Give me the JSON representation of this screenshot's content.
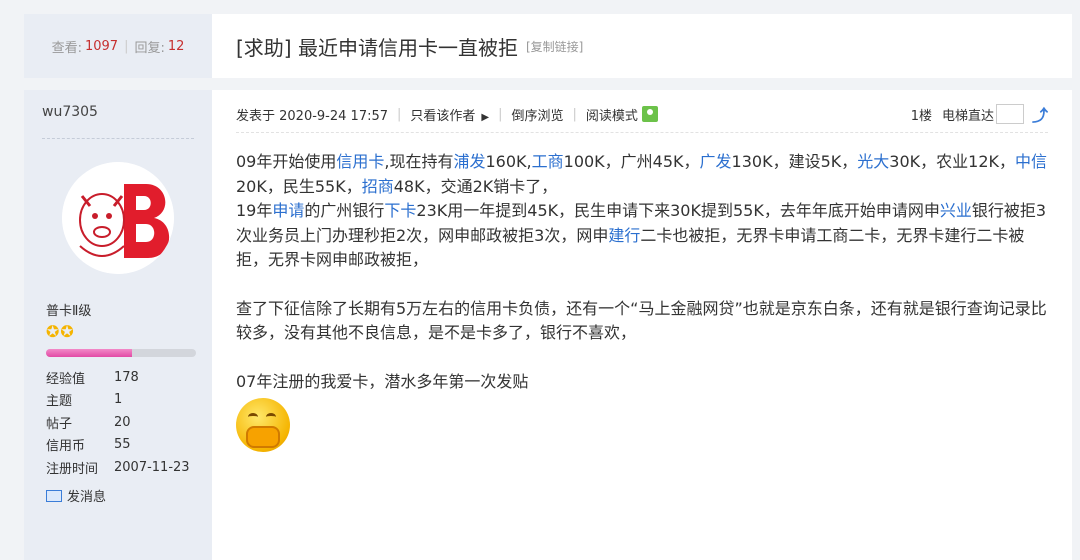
{
  "header": {
    "views_label": "查看:",
    "views_value": "1097",
    "replies_label": "回复:",
    "replies_value": "12",
    "thread_title": "[求助] 最近申请信用卡一直被拒",
    "copy_link": "[复制链接]"
  },
  "author": {
    "username": "wu7305",
    "avatar_letter": "B",
    "rank": "普卡Ⅱ级",
    "stars": "✪✪",
    "level_progress": 0.57,
    "stats": [
      {
        "label": "经验值",
        "value": "178"
      },
      {
        "label": "主题",
        "value": "1"
      },
      {
        "label": "帖子",
        "value": "20"
      },
      {
        "label": "信用币",
        "value": "55"
      },
      {
        "label": "注册时间",
        "value": "2007-11-23"
      }
    ],
    "send_message": "发消息"
  },
  "post_meta": {
    "posted": "发表于 2020-9-24 17:57",
    "only_author": "只看该作者",
    "reverse": "倒序浏览",
    "read_mode": "阅读模式",
    "floor": "1楼",
    "elevator": "电梯直达"
  },
  "post": {
    "p1": [
      "09年开始使用",
      "信用卡",
      ",现在持有",
      "浦发",
      "160K,",
      "工商",
      "100K，广州45K，",
      "广发",
      "130K，建设5K，",
      "光大",
      "30K，农业12K，",
      "中信",
      " 20K，民生55K，",
      "招商",
      "48K，交通2K销卡了，"
    ],
    "p2": [
      "19年",
      "申请",
      "的广州银行",
      "下卡",
      "23K用一年提到45K，民生申请下来30K提到55K，去年年底开始申请网申",
      "兴业",
      "银行被拒3次业务员上门办理秒拒2次，网申邮政被拒3次，网申",
      "建行",
      "二卡也被拒，无界卡申请工商二卡，无界卡建行二卡被拒，无界卡网申邮政被拒，"
    ],
    "p3": "查了下征信除了长期有5万左右的信用卡负债，还有一个“马上金融网贷”也就是京东白条，还有就是银行查询记录比较多，没有其他不良信息，是不是卡多了，银行不喜欢，",
    "p4": "07年注册的我爱卡，潜水多年第一次发贴"
  }
}
